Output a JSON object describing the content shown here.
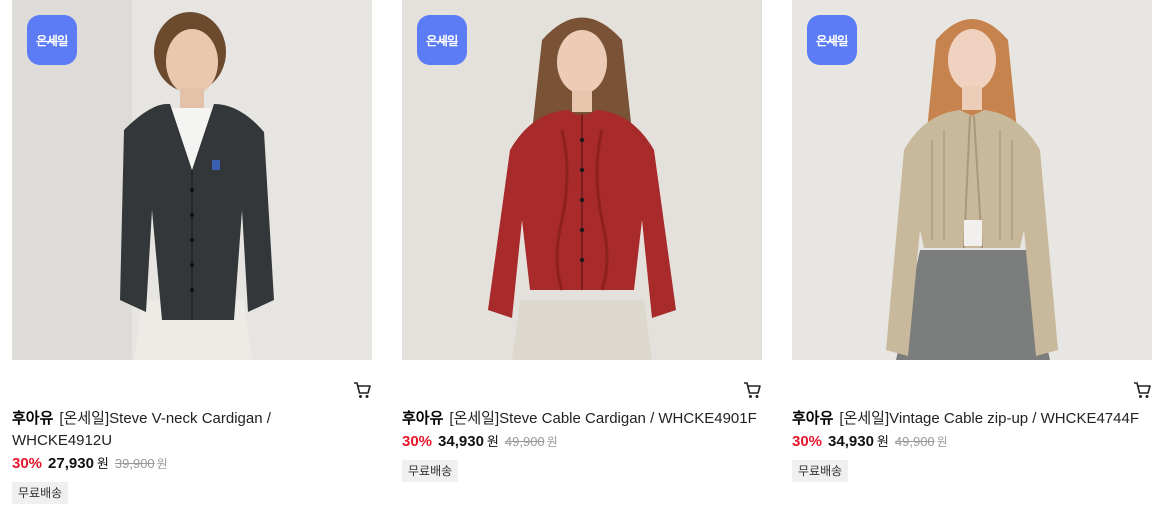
{
  "products": [
    {
      "badge": "온세일",
      "brand": "후아유",
      "name": "[온세일]Steve V-neck Cardigan / WHCKE4912U",
      "discount": "30%",
      "sale_price": "27,930",
      "currency": "원",
      "original_price": "39,900",
      "shipping_tag": "무료배송",
      "cardigan_color": "#34373a",
      "cart_icon": "cart-icon"
    },
    {
      "badge": "온세일",
      "brand": "후아유",
      "name": "[온세일]Steve Cable Cardigan / WHCKE4901F",
      "discount": "30%",
      "sale_price": "34,930",
      "currency": "원",
      "original_price": "49,900",
      "shipping_tag": "무료배송",
      "cardigan_color": "#a82a2a",
      "cart_icon": "cart-icon"
    },
    {
      "badge": "온세일",
      "brand": "후아유",
      "name": "[온세일]Vintage Cable zip-up / WHCKE4744F",
      "discount": "30%",
      "sale_price": "34,930",
      "currency": "원",
      "original_price": "49,900",
      "shipping_tag": "무료배송",
      "cardigan_color": "#c9b99c",
      "cart_icon": "cart-icon"
    }
  ],
  "colors": {
    "badge_bg": "#5b7cf5",
    "discount": "#e8162b",
    "photo_bg": "#e6e4e0"
  }
}
